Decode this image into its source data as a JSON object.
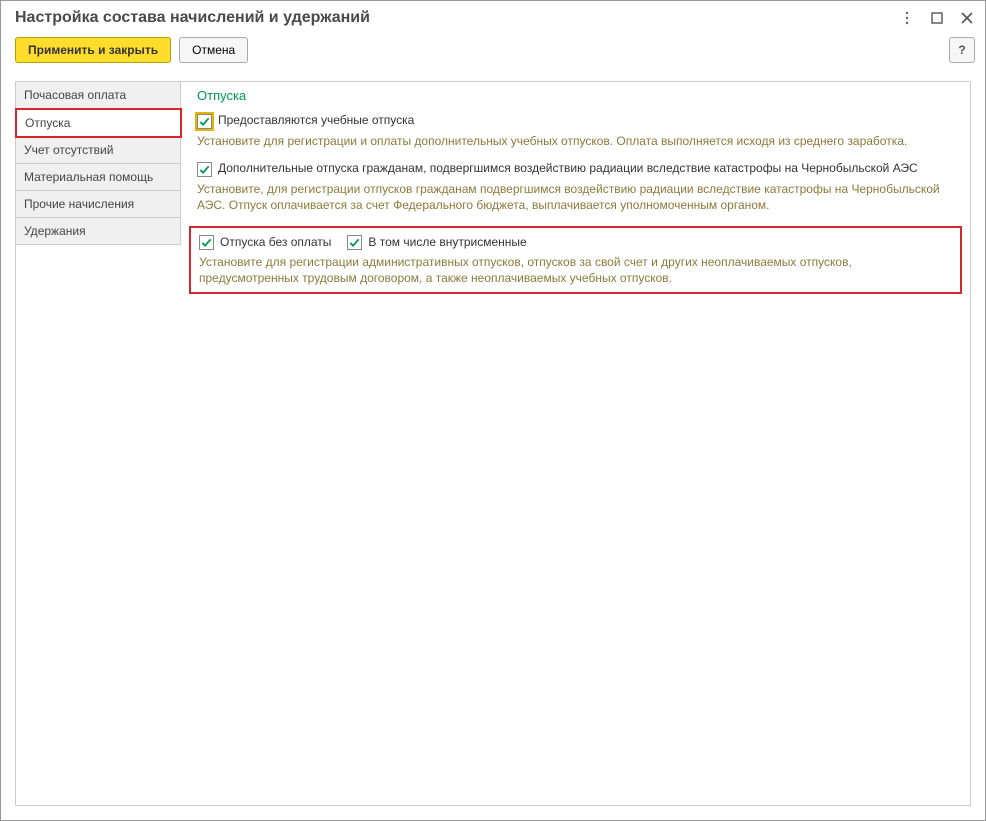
{
  "header": {
    "title": "Настройка состава начислений и удержаний"
  },
  "toolbar": {
    "apply_close": "Применить и закрыть",
    "cancel": "Отмена",
    "help": "?"
  },
  "sidebar": {
    "tabs": [
      "Почасовая оплата",
      "Отпуска",
      "Учет отсутствий",
      "Материальная помощь",
      "Прочие начисления",
      "Удержания"
    ]
  },
  "content": {
    "title": "Отпуска",
    "cb1_label": "Предоставляются учебные отпуска",
    "cb1_help": "Установите для регистрации и оплаты дополнительных учебных отпусков. Оплата выполняется исходя из среднего заработка.",
    "cb2_label": "Дополнительные отпуска гражданам, подвергшимся воздействию радиации вследствие катастрофы на Чернобыльской АЭС",
    "cb2_help": "Установите, для регистрации отпусков гражданам подвергшимся воздействию радиации вследствие катастрофы на Чернобыльской АЭС. Отпуск оплачивается за счет Федерального бюджета, выплачивается уполномоченным органом.",
    "cb3_label": "Отпуска без оплаты",
    "cb4_label": "В том числе внутрисменные",
    "cb3_help": "Установите для регистрации административных отпусков, отпусков за свой счет и других неоплачиваемых отпусков, предусмотренных трудовым договором, а также неоплачиваемых учебных отпусков."
  }
}
